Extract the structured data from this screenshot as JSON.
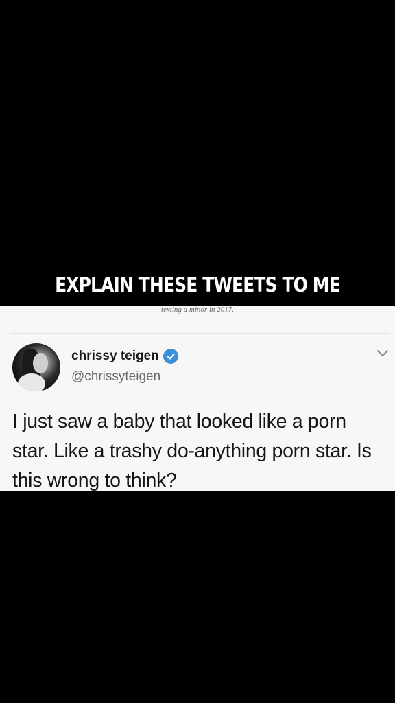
{
  "caption": "EXPLAIN THESE TWEETS TO ME",
  "previous_tweet_fragment": "texting a minor in 2017.",
  "tweet": {
    "display_name": "chrissy teigen",
    "handle": "@chrissyteigen",
    "verified": true,
    "text": "I just saw a baby that looked like a porn star. Like a trashy do-anything porn star. Is this wrong to think?",
    "menu_icon": "chevron-down-icon",
    "avatar_icon": "avatar"
  },
  "colors": {
    "background": "#000000",
    "card": "#f7f7f7",
    "verified_badge": "#3b8fd9",
    "caption_text": "#ffffff"
  }
}
